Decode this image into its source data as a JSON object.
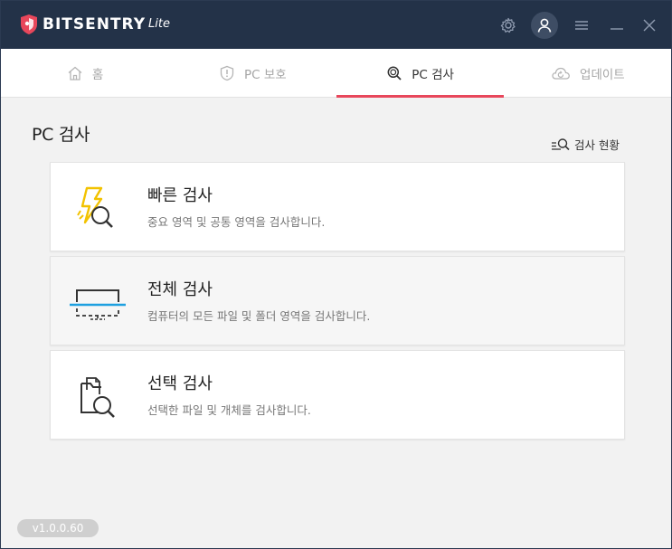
{
  "app": {
    "brand": "BITSENTRY",
    "brand_suffix": "Lite",
    "version": "v1.0.0.60",
    "colors": {
      "titlebar": "#233248",
      "accent": "#e8475b",
      "bolt": "#f2c200",
      "scan_line": "#1ea0e0"
    }
  },
  "titlebar": {
    "icons": [
      "gear-icon",
      "user-icon",
      "menu-icon",
      "minimize-icon",
      "close-icon"
    ]
  },
  "tabs": [
    {
      "label": "홈",
      "icon": "home-icon",
      "active": false
    },
    {
      "label": "PC 보호",
      "icon": "shield-icon",
      "active": false
    },
    {
      "label": "PC 검사",
      "icon": "search-icon",
      "active": true
    },
    {
      "label": "업데이트",
      "icon": "cloud-update-icon",
      "active": false
    }
  ],
  "main": {
    "title": "PC 검사",
    "status_link": "검사 현황",
    "cards": [
      {
        "title": "빠른 검사",
        "desc": "중요 영역 및 공통 영역을 검사합니다.",
        "icon": "quick-scan-icon"
      },
      {
        "title": "전체 검사",
        "desc": "컴퓨터의 모든 파일 및 폴더 영역을 검사합니다.",
        "icon": "full-scan-icon"
      },
      {
        "title": "선택 검사",
        "desc": "선택한 파일 및 개체를 검사합니다.",
        "icon": "custom-scan-icon"
      }
    ]
  }
}
